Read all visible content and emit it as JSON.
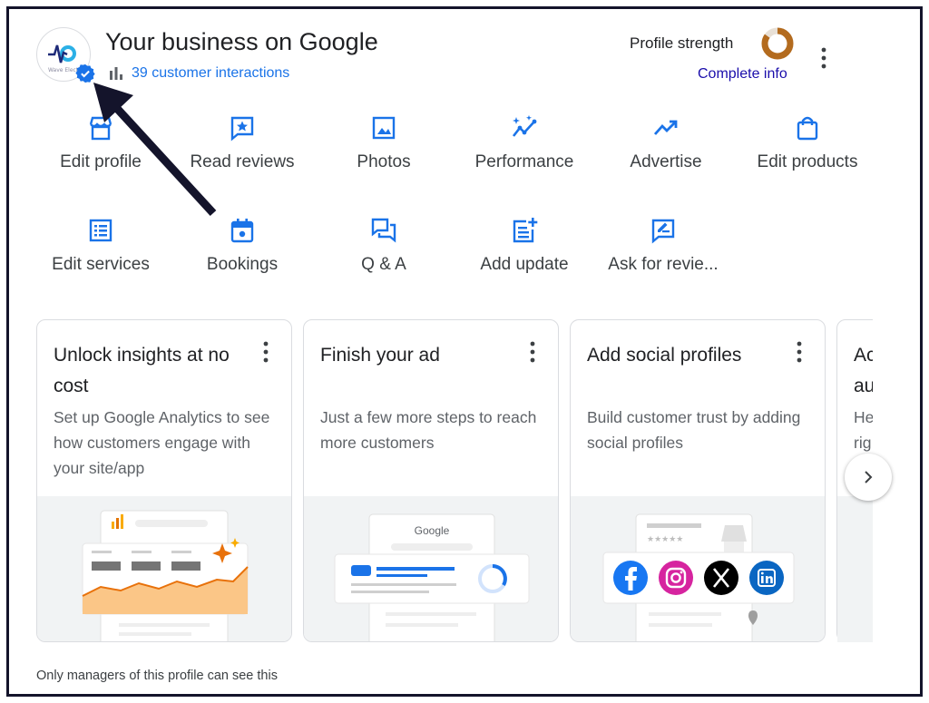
{
  "header": {
    "title": "Your business on Google",
    "interactions": "39 customer interactions",
    "profile_strength_label": "Profile strength",
    "profile_strength_level": 0.85,
    "complete_info": "Complete info",
    "logo_text": "Wave Electric",
    "colors": {
      "link": "#1a73e8",
      "complete": "#1a0dab",
      "ring": "#b36b1e"
    }
  },
  "actions": [
    {
      "label": "Edit profile",
      "icon": "storefront-icon"
    },
    {
      "label": "Read reviews",
      "icon": "star-review-icon"
    },
    {
      "label": "Photos",
      "icon": "image-icon"
    },
    {
      "label": "Performance",
      "icon": "sparkle-trend-icon"
    },
    {
      "label": "Advertise",
      "icon": "trending-up-icon"
    },
    {
      "label": "Edit products",
      "icon": "shopping-bag-icon"
    },
    {
      "label": "Edit services",
      "icon": "list-icon"
    },
    {
      "label": "Bookings",
      "icon": "calendar-icon"
    },
    {
      "label": "Q & A",
      "icon": "chat-bubbles-icon"
    },
    {
      "label": "Add update",
      "icon": "post-add-icon"
    },
    {
      "label": "Ask for revie...",
      "icon": "rate-review-icon"
    }
  ],
  "cards": [
    {
      "title": "Unlock insights at no cost",
      "body": "Set up Google Analytics to see how customers engage with your site/app"
    },
    {
      "title": "Finish your ad",
      "body": "Just a few more steps to reach more customers",
      "illus_text": "Google"
    },
    {
      "title": "Add social profiles",
      "body": "Build customer trust by adding social profiles",
      "social": [
        "facebook",
        "instagram",
        "x",
        "linkedin"
      ]
    },
    {
      "title": "Ac au",
      "body": "He rig ch"
    }
  ],
  "footer_note": "Only managers of this profile can see this"
}
